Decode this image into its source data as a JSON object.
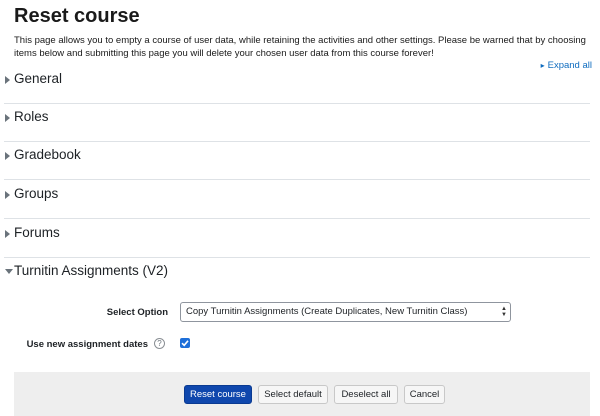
{
  "page": {
    "title": "Reset course",
    "intro": "This page allows you to empty a course of user data, while retaining the activities and other settings. Please be warned that by choosing items below and submitting this page you will delete your chosen user data from this course forever!",
    "expand_all": "Expand all"
  },
  "sections": [
    {
      "label": "General",
      "expanded": false
    },
    {
      "label": "Roles",
      "expanded": false
    },
    {
      "label": "Gradebook",
      "expanded": false
    },
    {
      "label": "Groups",
      "expanded": false
    },
    {
      "label": "Forums",
      "expanded": false
    },
    {
      "label": "Turnitin Assignments (V2)",
      "expanded": true
    }
  ],
  "turnitin": {
    "select_option_label": "Select Option",
    "select_option_value": "Copy Turnitin Assignments (Create Duplicates, New Turnitin Class)",
    "use_new_dates_label": "Use new assignment dates",
    "use_new_dates_checked": true
  },
  "buttons": {
    "reset": "Reset course",
    "select_default": "Select default",
    "deselect_all": "Deselect all",
    "cancel": "Cancel"
  },
  "colors": {
    "link": "#0f6cbf",
    "primary_button": "#0f47ad",
    "checkbox": "#1e6fd9"
  }
}
